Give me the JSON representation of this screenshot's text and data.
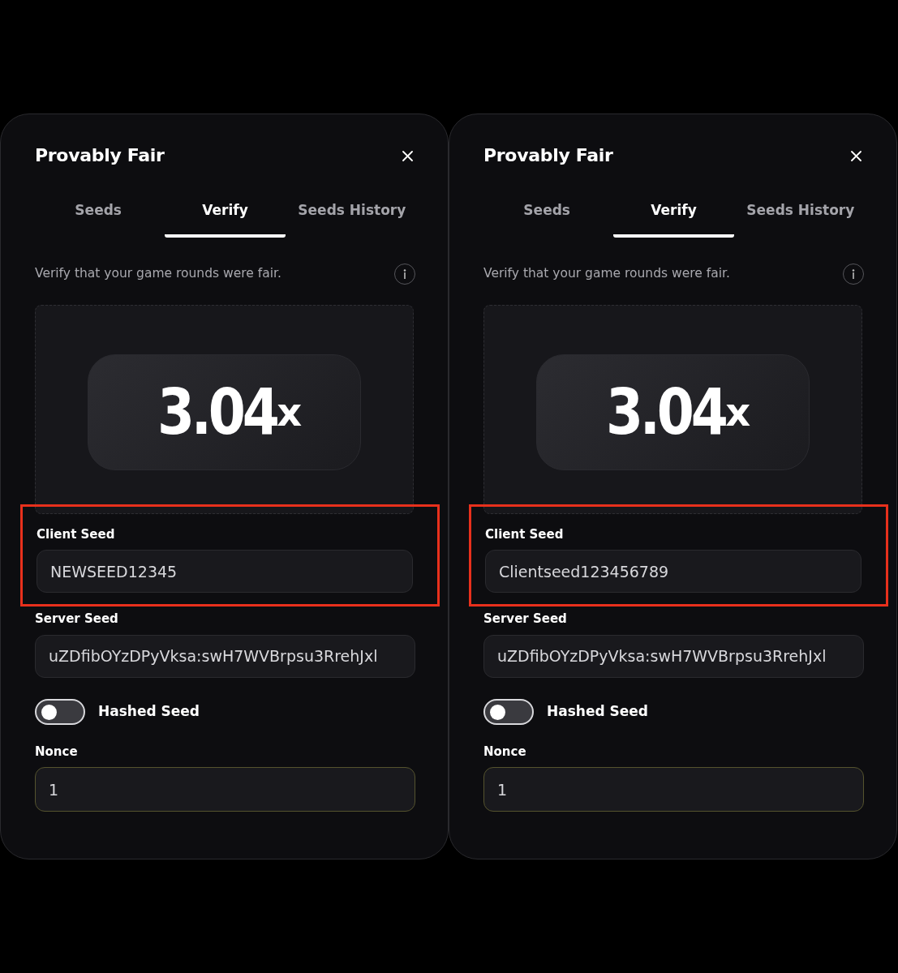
{
  "panels": [
    {
      "title": "Provably Fair",
      "tabs": [
        {
          "label": "Seeds",
          "selected": false
        },
        {
          "label": "Verify",
          "selected": true
        },
        {
          "label": "Seeds History",
          "selected": false
        }
      ],
      "description": "Verify that your game rounds were fair.",
      "multiplier": {
        "value": "3.04",
        "suffix": "x"
      },
      "client_seed": {
        "label": "Client Seed",
        "value": "NEWSEED12345",
        "highlighted": true
      },
      "server_seed": {
        "label": "Server Seed",
        "value": "uZDfibOYzDPyVksa:swH7WVBrpsu3RrehJxl"
      },
      "hashed_seed": {
        "label": "Hashed Seed",
        "on": false
      },
      "nonce": {
        "label": "Nonce",
        "value": "1",
        "focused": true
      }
    },
    {
      "title": "Provably Fair",
      "tabs": [
        {
          "label": "Seeds",
          "selected": false
        },
        {
          "label": "Verify",
          "selected": true
        },
        {
          "label": "Seeds History",
          "selected": false
        }
      ],
      "description": "Verify that your game rounds were fair.",
      "multiplier": {
        "value": "3.04",
        "suffix": "x"
      },
      "client_seed": {
        "label": "Client Seed",
        "value": "Clientseed123456789",
        "highlighted": true
      },
      "server_seed": {
        "label": "Server Seed",
        "value": "uZDfibOYzDPyVksa:swH7WVBrpsu3RrehJxl"
      },
      "hashed_seed": {
        "label": "Hashed Seed",
        "on": false
      },
      "nonce": {
        "label": "Nonce",
        "value": "1",
        "focused": true
      }
    }
  ]
}
